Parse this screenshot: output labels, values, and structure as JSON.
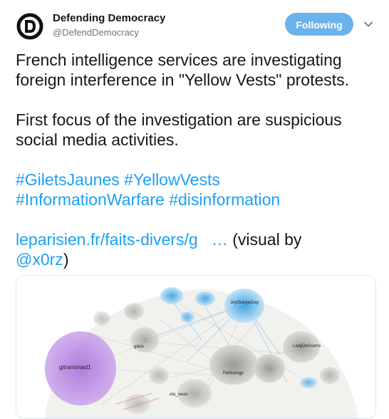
{
  "account": {
    "display_name": "Defending Democracy",
    "handle": "@DefendDemocracy",
    "avatar_letter": "D",
    "follow_label": "Following"
  },
  "tweet": {
    "line1": "French intelligence services are investigating",
    "line2": "foreign interference in \"Yellow Vests\" protests.",
    "line3": "First focus of the investigation are suspicious",
    "line4": "social media activities.",
    "hashtags": {
      "giletsjaunes": "#GiletsJaunes",
      "yellowvests": "#YellowVests",
      "informationwarfare": "#InformationWarfare",
      "disinformation": "#disinformation"
    },
    "url": "leparisien.fr/faits-divers/g",
    "ellipsis": "…",
    "visual_by": "(visual by",
    "mention": "@x0rz",
    "close_paren": ")"
  },
  "media": {
    "labels": {
      "gitranomad": "gitranomad1",
      "joy": "JoyOrangeDay",
      "lady": "LadyDeGuerre",
      "partisan": "Partisangp",
      "eta": "eta_news",
      "small": "gilets"
    }
  },
  "colors": {
    "accent": "#1da1f2",
    "follow_bg": "#6ab3ea",
    "text": "#14171a",
    "muted": "#657786"
  }
}
